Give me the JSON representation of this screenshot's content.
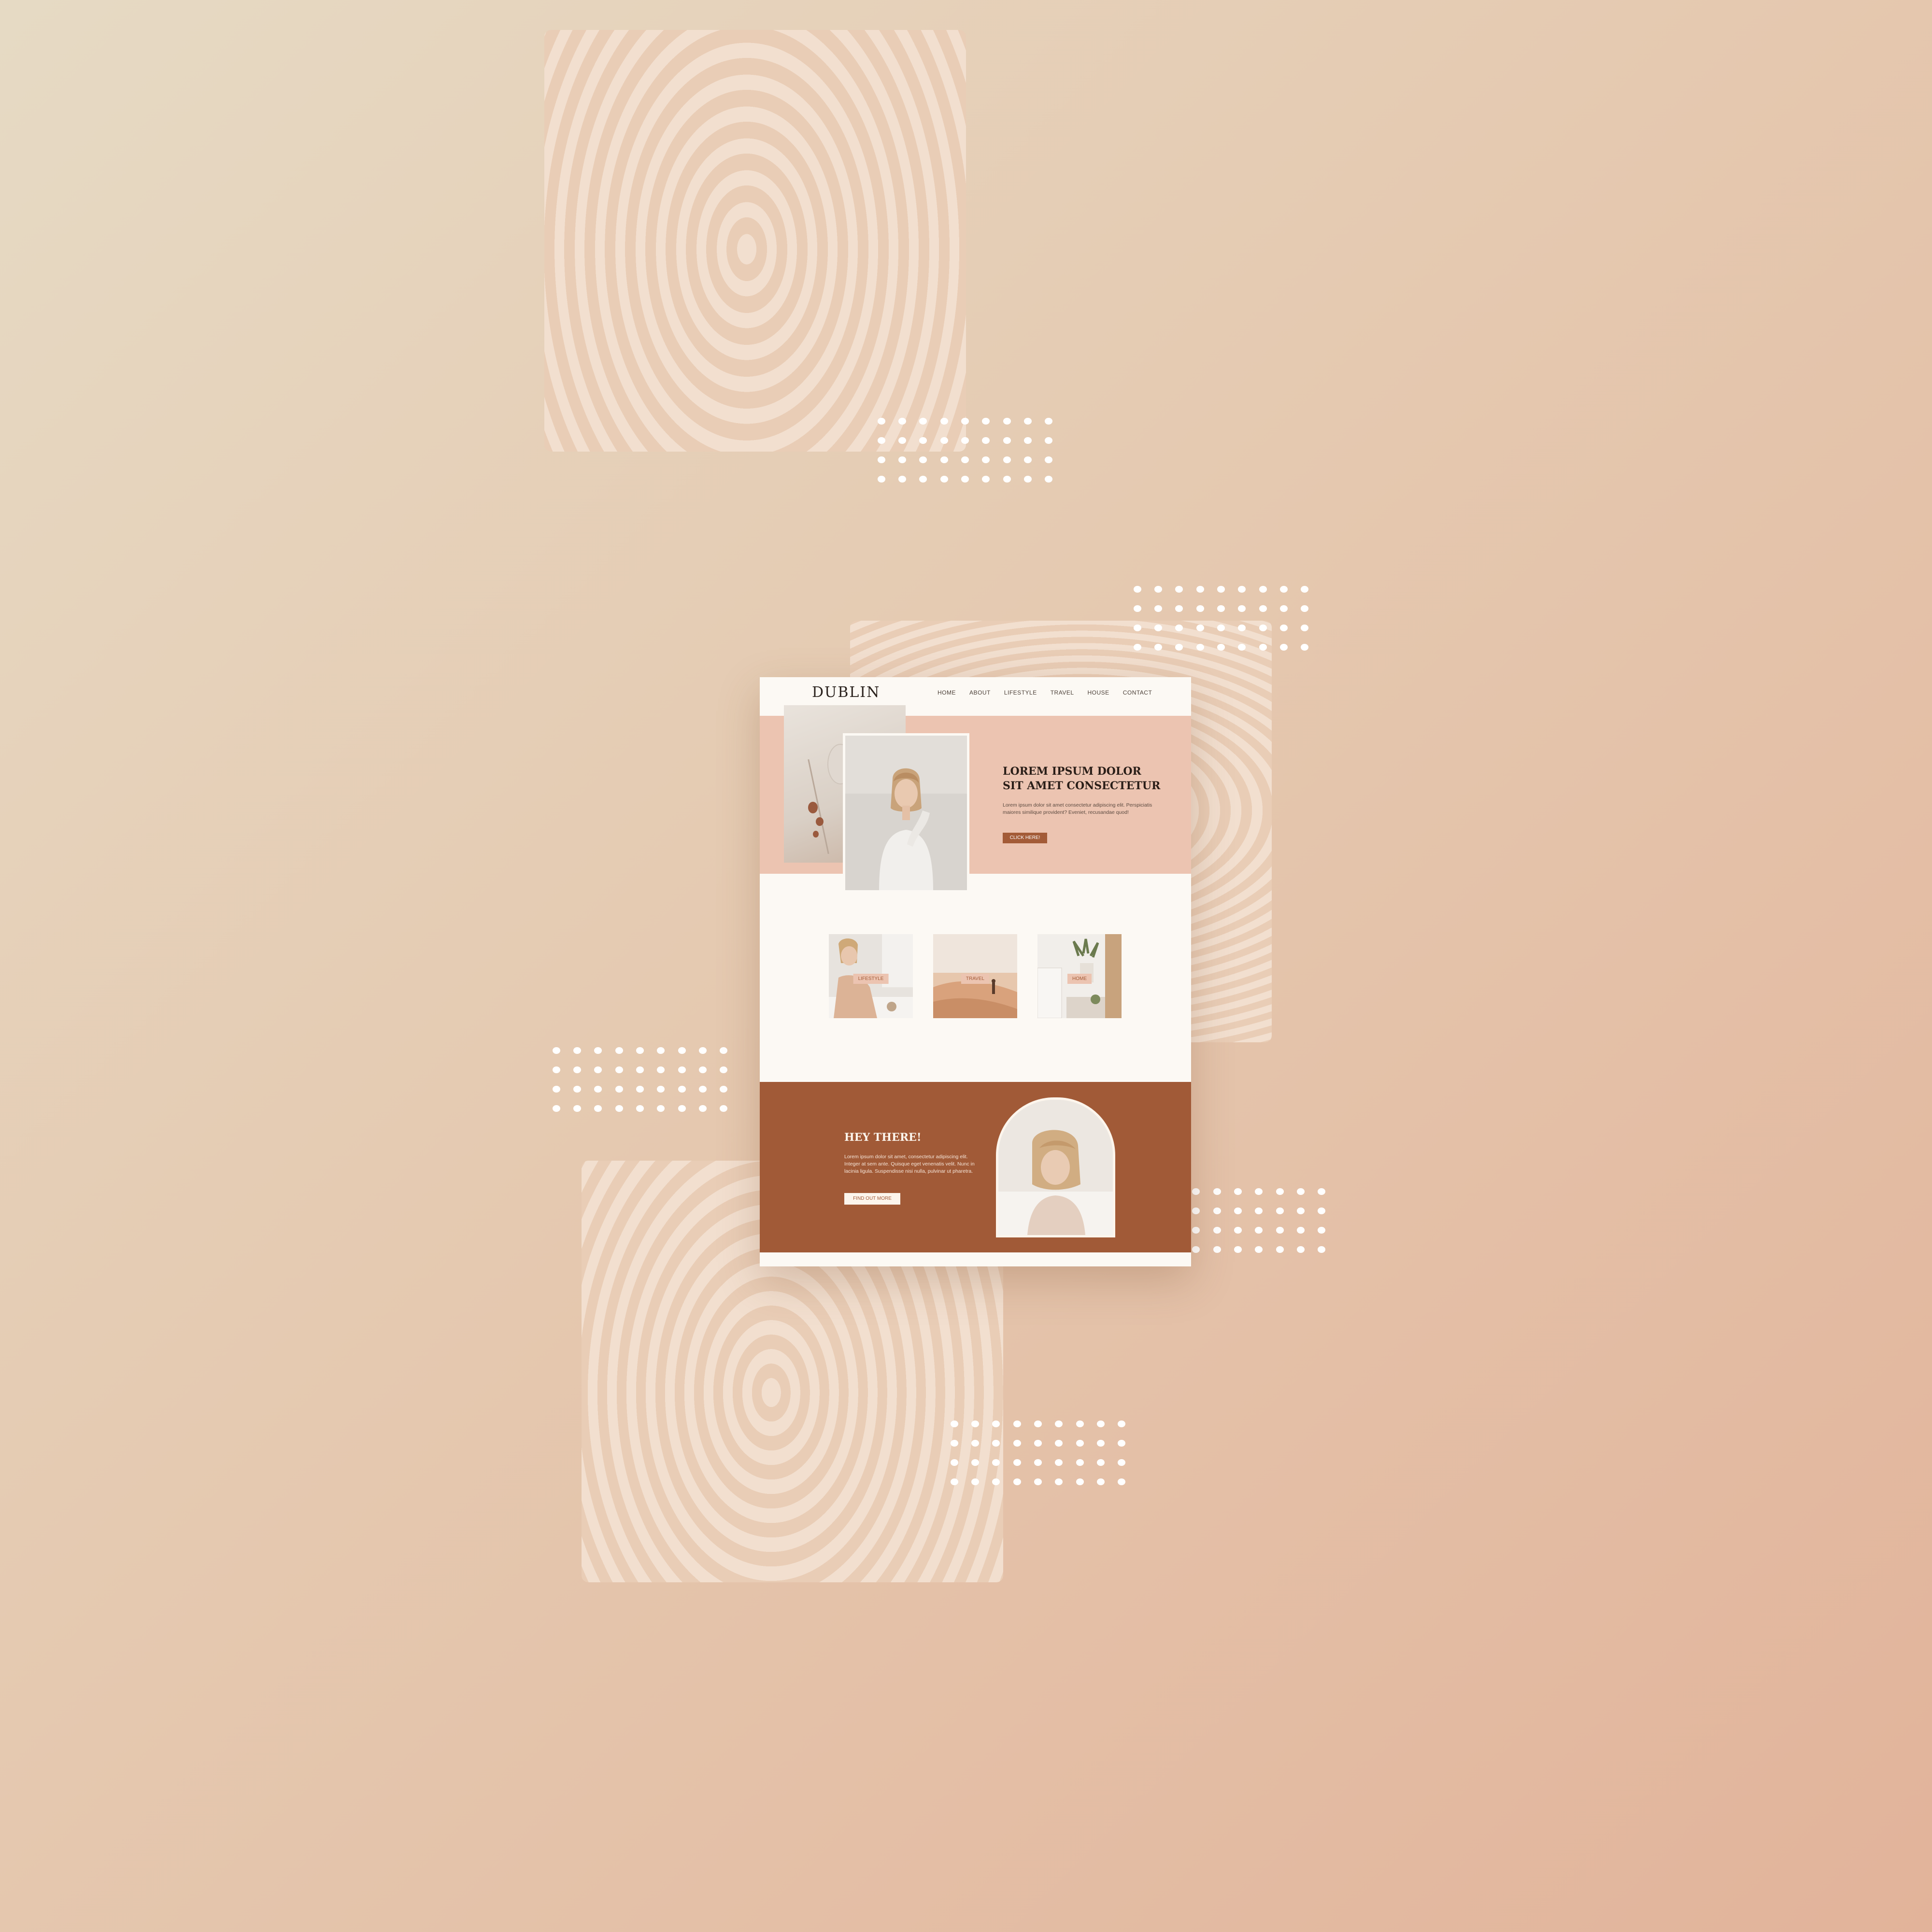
{
  "site": {
    "logo": "DUBLIN",
    "nav": [
      "HOME",
      "ABOUT",
      "LIFESTYLE",
      "TRAVEL",
      "HOUSE",
      "CONTACT"
    ],
    "hero": {
      "title": "LOREM IPSUM DOLOR SIT AMET CONSECTETUR",
      "text": "Lorem ipsum dolor sit amet consectetur adipiscing elit. Perspiciatis maiores similique provident? Eveniet, recusandae quod!",
      "button": "CLICK HERE!"
    },
    "categories": [
      "LIFESTYLE",
      "TRAVEL",
      "HOME"
    ],
    "about": {
      "title": "HEY THERE!",
      "text": "Lorem ipsum dolor sit amet, consectetur adipiscing elit. Integer at sem ante. Quisque eget venenatis velit. Nunc in lacinia ligula. Suspendisse nisi nulla, pulvinar ut pharetra.",
      "button": "FIND OUT MORE"
    }
  },
  "colors": {
    "accent": "#a15a37",
    "blush": "#ecc4b1",
    "cream": "#fcf9f4"
  }
}
